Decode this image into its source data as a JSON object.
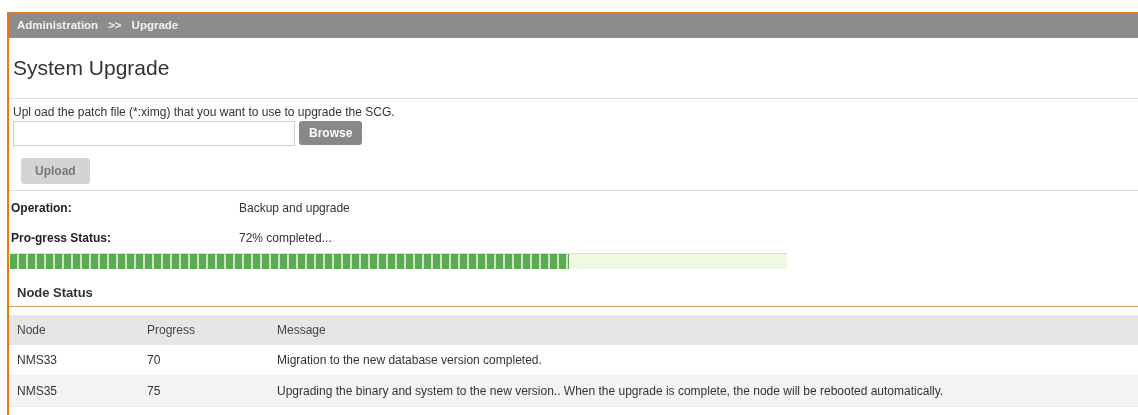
{
  "breadcrumb": {
    "items": [
      "Administration",
      "Upgrade"
    ],
    "separator": ">>"
  },
  "title": "System Upgrade",
  "upload": {
    "instruction": "Upl oad the patch file (*:ximg) that you want to use to upgrade the SCG.",
    "browse_label": "Browse",
    "upload_label": "Upload",
    "upload_disabled": true
  },
  "operation": {
    "label": "Operation:",
    "value": "Backup and upgrade"
  },
  "progress": {
    "label": "Pro-gress Status:",
    "value": "72% completed...",
    "level": 0.72
  },
  "node_status": {
    "heading": "Node Status",
    "columns": [
      "Node",
      "Progress",
      "Message"
    ],
    "rows": [
      {
        "node": "NMS33",
        "progress": "70",
        "message": "Migration to the new database version completed."
      },
      {
        "node": "NMS35",
        "progress": "75",
        "message": "Upgrading the binary and system to the new version.. When the upgrade is complete, the node will be rebooted automatically."
      }
    ]
  }
}
